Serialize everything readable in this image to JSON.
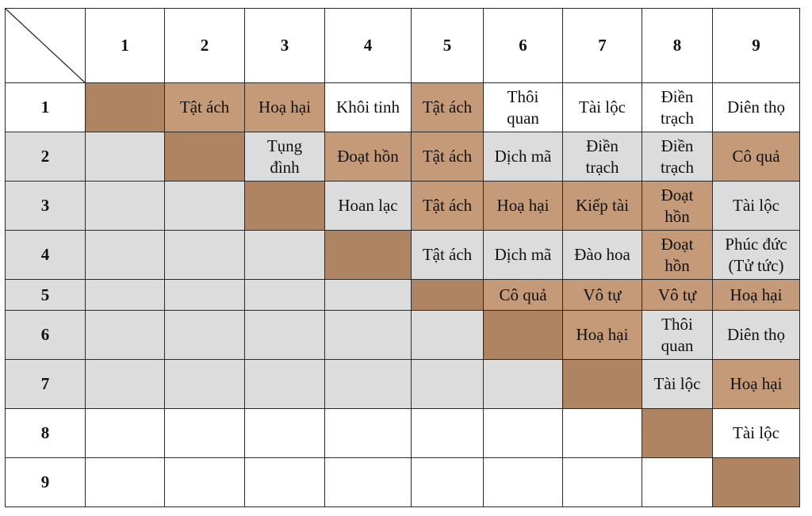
{
  "header": [
    "1",
    "2",
    "3",
    "4",
    "5",
    "6",
    "7",
    "8",
    "9"
  ],
  "rows": [
    {
      "label": "1",
      "cells": [
        "",
        "Tật ách",
        "Hoạ hại",
        "Khôi tinh",
        "Tật ách",
        "Thôi\nquan",
        "Tài lộc",
        "Điền\ntrạch",
        "Diên thọ"
      ]
    },
    {
      "label": "2",
      "cells": [
        "",
        "",
        "Tụng\nđình",
        "Đoạt hồn",
        "Tật ách",
        "Dịch mã",
        "Điền\ntrạch",
        "Điền\ntrạch",
        "Cô quả"
      ]
    },
    {
      "label": "3",
      "cells": [
        "",
        "",
        "",
        "Hoan lạc",
        "Tật ách",
        "Hoạ hại",
        "Kiếp tài",
        "Đoạt\nhồn",
        "Tài lộc"
      ]
    },
    {
      "label": "4",
      "cells": [
        "",
        "",
        "",
        "",
        "Tật ách",
        "Dịch mã",
        "Đào hoa",
        "Đoạt\nhồn",
        "Phúc đức\n(Tử tức)"
      ]
    },
    {
      "label": "5",
      "cells": [
        "",
        "",
        "",
        "",
        "",
        "Cô quả",
        "Vô tự",
        "Vô tự",
        "Hoạ hại"
      ]
    },
    {
      "label": "6",
      "cells": [
        "",
        "",
        "",
        "",
        "",
        "",
        "Hoạ hại",
        "Thôi\nquan",
        "Diên thọ"
      ]
    },
    {
      "label": "7",
      "cells": [
        "",
        "",
        "",
        "",
        "",
        "",
        "",
        "Tài lộc",
        "Hoạ hại"
      ]
    },
    {
      "label": "8",
      "cells": [
        "",
        "",
        "",
        "",
        "",
        "",
        "",
        "",
        "Tài lộc"
      ]
    },
    {
      "label": "9",
      "cells": [
        "",
        "",
        "",
        "",
        "",
        "",
        "",
        "",
        ""
      ]
    }
  ],
  "tan_cells": [
    [
      0,
      1
    ],
    [
      0,
      2
    ],
    [
      0,
      4
    ],
    [
      1,
      3
    ],
    [
      1,
      4
    ],
    [
      1,
      8
    ],
    [
      2,
      4
    ],
    [
      2,
      5
    ],
    [
      2,
      6
    ],
    [
      2,
      7
    ],
    [
      3,
      7
    ],
    [
      4,
      5
    ],
    [
      4,
      6
    ],
    [
      4,
      7
    ],
    [
      4,
      8
    ],
    [
      5,
      6
    ],
    [
      6,
      8
    ]
  ],
  "colors": {
    "tan": "#c49a78",
    "diagonal": "#a67b5b",
    "band": "#dcdcdc",
    "border": "#2a2a2a"
  }
}
